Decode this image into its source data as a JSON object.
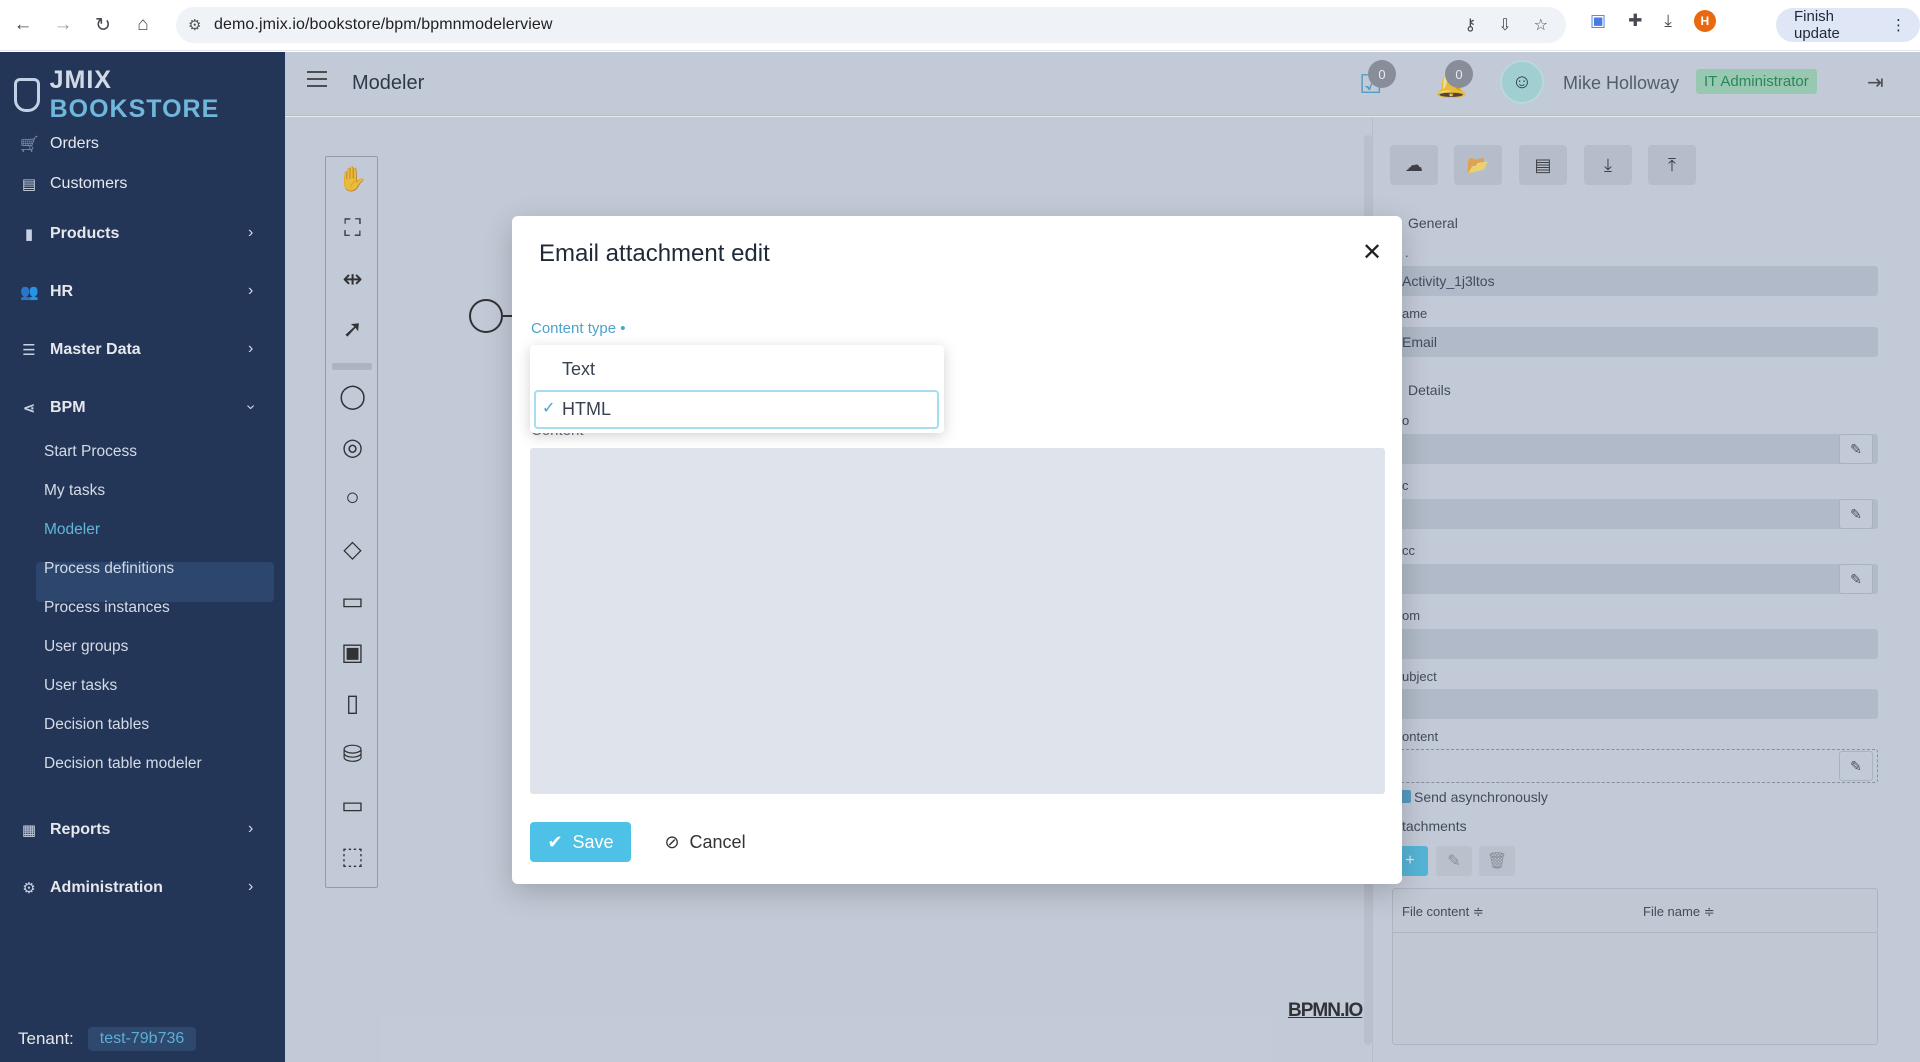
{
  "browser": {
    "url": "demo.jmix.io/bookstore/bpm/bpmnmodelerview",
    "profile_initial": "H",
    "finish_update_label": "Finish update"
  },
  "sidebar": {
    "logo_prefix": "JMIX",
    "logo_suffix": "BOOKSTORE",
    "items": [
      {
        "label": "Orders"
      },
      {
        "label": "Customers"
      },
      {
        "label": "Products"
      },
      {
        "label": "HR"
      },
      {
        "label": "Master Data"
      },
      {
        "label": "BPM"
      },
      {
        "label": "Reports"
      },
      {
        "label": "Administration"
      }
    ],
    "bpm_sub": [
      {
        "label": "Start Process"
      },
      {
        "label": "My tasks"
      },
      {
        "label": "Modeler"
      },
      {
        "label": "Process definitions"
      },
      {
        "label": "Process instances"
      },
      {
        "label": "User groups"
      },
      {
        "label": "User tasks"
      },
      {
        "label": "Decision tables"
      },
      {
        "label": "Decision table modeler"
      }
    ],
    "tenant_label": "Tenant:",
    "tenant_value": "test-79b736"
  },
  "header": {
    "title": "Modeler",
    "tasks_count": "0",
    "notifications_count": "0",
    "user_name": "Mike Holloway",
    "user_role": "IT Administrator"
  },
  "canvas": {
    "watermark": "BPMN.IO"
  },
  "properties": {
    "general_label": "General",
    "id_label": ".",
    "id_value": "Activity_1j3ltos",
    "name_label": "ame",
    "name_value": "Email",
    "details_label": "Details",
    "to_label": "o",
    "cc_label": "c",
    "bcc_label": "cc",
    "from_label": "om",
    "subject_label": "ubject",
    "content_label": "ontent",
    "send_async_label": "Send asynchronously",
    "attachments_label": "tachments",
    "col_file_content": "File content ≑",
    "col_file_name": "File name ≑"
  },
  "dialog": {
    "title": "Email attachment edit",
    "content_type_label": "Content type •",
    "content_label": "Content",
    "save_label": "Save",
    "cancel_label": "Cancel",
    "options": [
      "Text",
      "HTML"
    ],
    "selected_option": "HTML"
  },
  "colors": {
    "sidebar_bg": "#10264a",
    "accent": "#4ec1e6",
    "role_badge": "#9fd8b8"
  }
}
